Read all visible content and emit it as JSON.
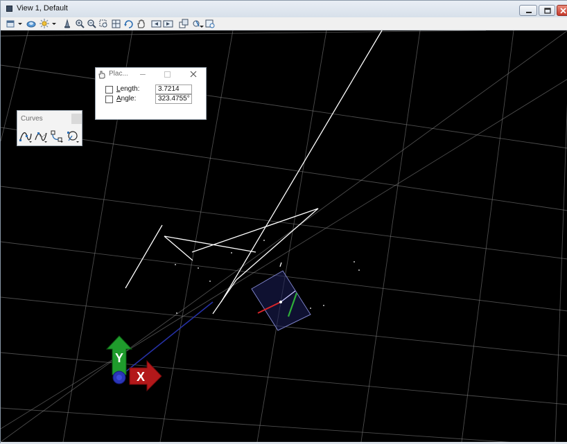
{
  "window": {
    "title": "View 1, Default"
  },
  "place_dialog": {
    "title": "Plac...",
    "length_label_key": "L",
    "length_label_rest": "ength:",
    "length_value": "3.7214",
    "angle_label_key": "A",
    "angle_label_rest": "ngle:",
    "angle_value": "323.4755°"
  },
  "curves_toolbox": {
    "title": "Curves"
  },
  "axis_triad": {
    "y_label": "Y",
    "x_label": "X"
  },
  "colors": {
    "viewport_background": "#000000",
    "grid": "#8a8a8a",
    "elements": "#ffffff",
    "y_axis": "#1f9b2c",
    "x_axis": "#b3181a",
    "z_axis": "#2a36b8",
    "accudraw_compass": "#1c1f5a"
  }
}
